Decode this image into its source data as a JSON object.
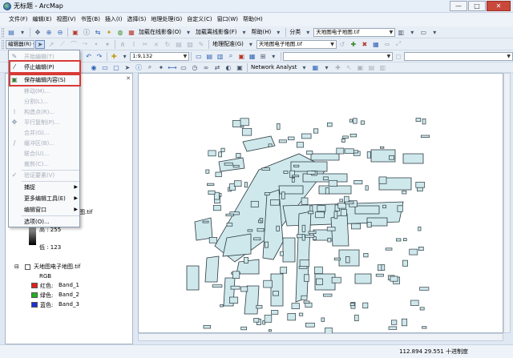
{
  "window": {
    "title": "无标题 - ArcMap",
    "min": "—",
    "max": "□",
    "close": "✕"
  },
  "menubar": [
    "文件(F)",
    "编辑(E)",
    "视图(V)",
    "书签(B)",
    "插入(I)",
    "选择(S)",
    "地理处理(G)",
    "自定义(C)",
    "窗口(W)",
    "帮助(H)"
  ],
  "toolbar1": {
    "basemap": "加载在线影像(O)",
    "offline": "加载离线影像(F)",
    "help": "帮助(H)",
    "classify": "分类",
    "layer_combo": "天地图电子地图.tif"
  },
  "toolbar2": {
    "editor": "编辑器(R)",
    "georef": "地理配准(G)",
    "georef_layer": "天地图电子地图.tif"
  },
  "toolbar3": {
    "scale": "1:9,132",
    "network": "Network Analyst"
  },
  "editor_menu": [
    {
      "label": "开始编辑(T)",
      "disabled": true
    },
    {
      "label": "停止编辑(P)",
      "disabled": false,
      "highlighted": true
    },
    {
      "label": "保存编辑内容(S)",
      "disabled": false,
      "highlighted": true
    },
    {
      "label": "移动(M)...",
      "disabled": true
    },
    {
      "label": "分割(L)...",
      "disabled": true
    },
    {
      "label": "构造点(R)...",
      "disabled": true
    },
    {
      "label": "平行复制(P)...",
      "disabled": true
    },
    {
      "label": "合并(G)...",
      "disabled": true
    },
    {
      "label": "缓冲区(B)...",
      "disabled": true
    },
    {
      "label": "联合(U)...",
      "disabled": true
    },
    {
      "label": "裁剪(C)...",
      "disabled": true
    },
    {
      "label": "验证要素(V)",
      "disabled": true
    },
    {
      "label": "捕捉",
      "disabled": false,
      "submenu": true
    },
    {
      "label": "更多编辑工具(E)",
      "disabled": false,
      "submenu": true
    },
    {
      "label": "编辑窗口",
      "disabled": false,
      "submenu": true
    },
    {
      "label": "选项(O)...",
      "disabled": false
    }
  ],
  "toc": {
    "hidden_layer_suffix": "图.tif",
    "high": "高 : 255",
    "low": "低 : 123",
    "layer_name": "天地图电子地图.tif",
    "rgb": "RGB",
    "bands": [
      {
        "label": "红色:",
        "band": "Band_1",
        "color": "#e0201a"
      },
      {
        "label": "绿色:",
        "band": "Band_2",
        "color": "#22b022"
      },
      {
        "label": "蓝色:",
        "band": "Band_3",
        "color": "#1c2fd6"
      }
    ]
  },
  "status": {
    "x": "112.894",
    "y": "29.551",
    "units": "十进制度"
  },
  "colors": {
    "building_fill": "#cfe8ec",
    "building_stroke": "#2a3a40",
    "highlight": "#d83a35"
  }
}
